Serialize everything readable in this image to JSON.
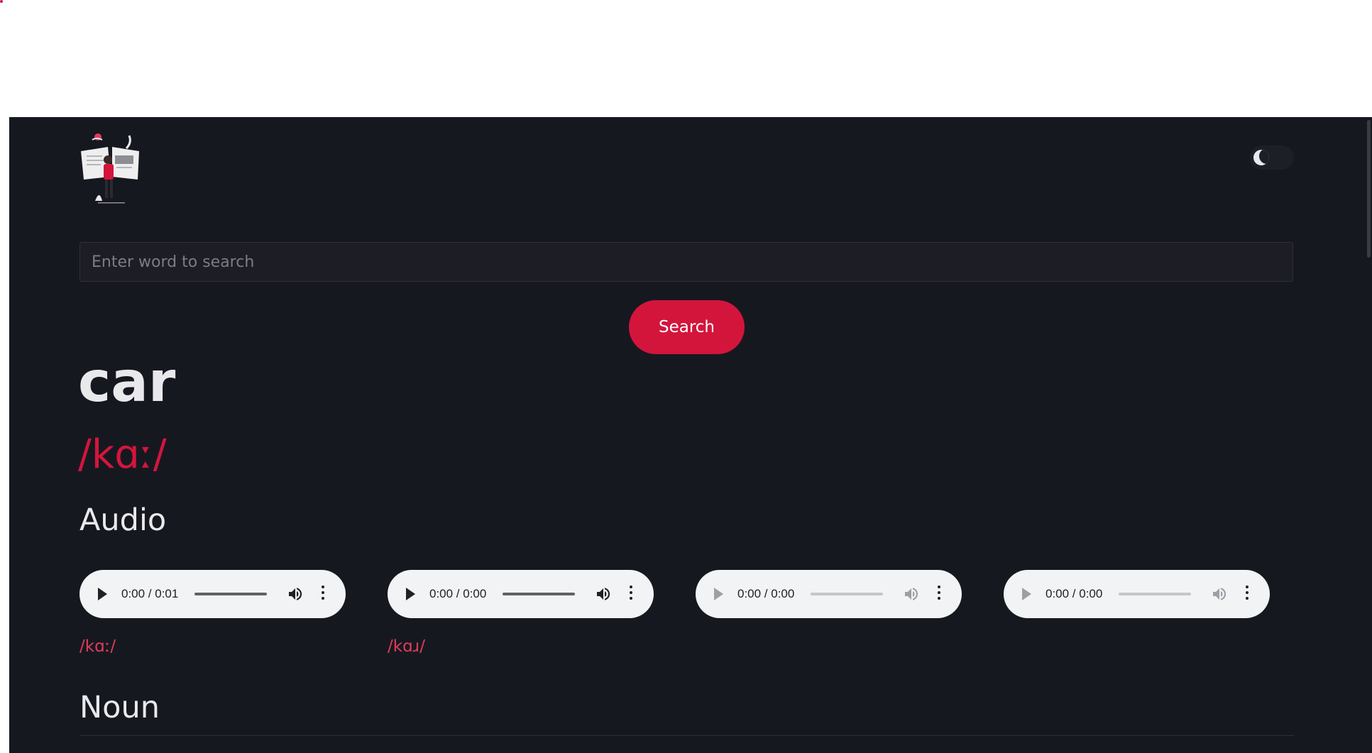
{
  "header": {
    "logo_alt": "dictionary illustration",
    "theme_toggle_icon": "moon-icon"
  },
  "search": {
    "placeholder": "Enter word to search",
    "value": "",
    "button_label": "Search"
  },
  "entry": {
    "word": "car",
    "phonetic": "/kɑː/",
    "audio_heading": "Audio",
    "audio_players": [
      {
        "time": "0:00 / 0:01",
        "enabled": true,
        "phonetic": "/kɑː/"
      },
      {
        "time": "0:00 / 0:00",
        "enabled": true,
        "phonetic": "/kɑɹ/"
      },
      {
        "time": "0:00 / 0:00",
        "enabled": false,
        "phonetic": ""
      },
      {
        "time": "0:00 / 0:00",
        "enabled": false,
        "phonetic": ""
      }
    ],
    "part_of_speech": "Noun"
  },
  "colors": {
    "background": "#161820",
    "accent": "#d3153c",
    "text": "#e9e9ec"
  }
}
